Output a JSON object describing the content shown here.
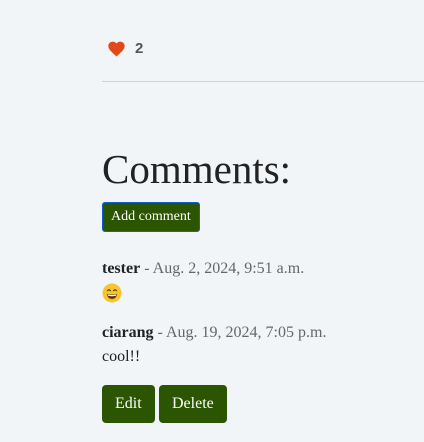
{
  "likes": {
    "icon": "heart-icon",
    "icon_color": "#e04a1a",
    "count": "2"
  },
  "comments_section": {
    "title": "Comments:",
    "add_button_label": "Add comment",
    "button_color": "#2b5500",
    "items": [
      {
        "author": "tester",
        "separator": " - ",
        "date": "Aug. 2, 2024, 9:51 a.m.",
        "body_icon": "grinning-face-emoji"
      },
      {
        "author": "ciarang",
        "separator": " - ",
        "date": "Aug. 19, 2024, 7:05 p.m.",
        "body": "cool!!"
      }
    ],
    "edit_label": "Edit",
    "delete_label": "Delete"
  }
}
